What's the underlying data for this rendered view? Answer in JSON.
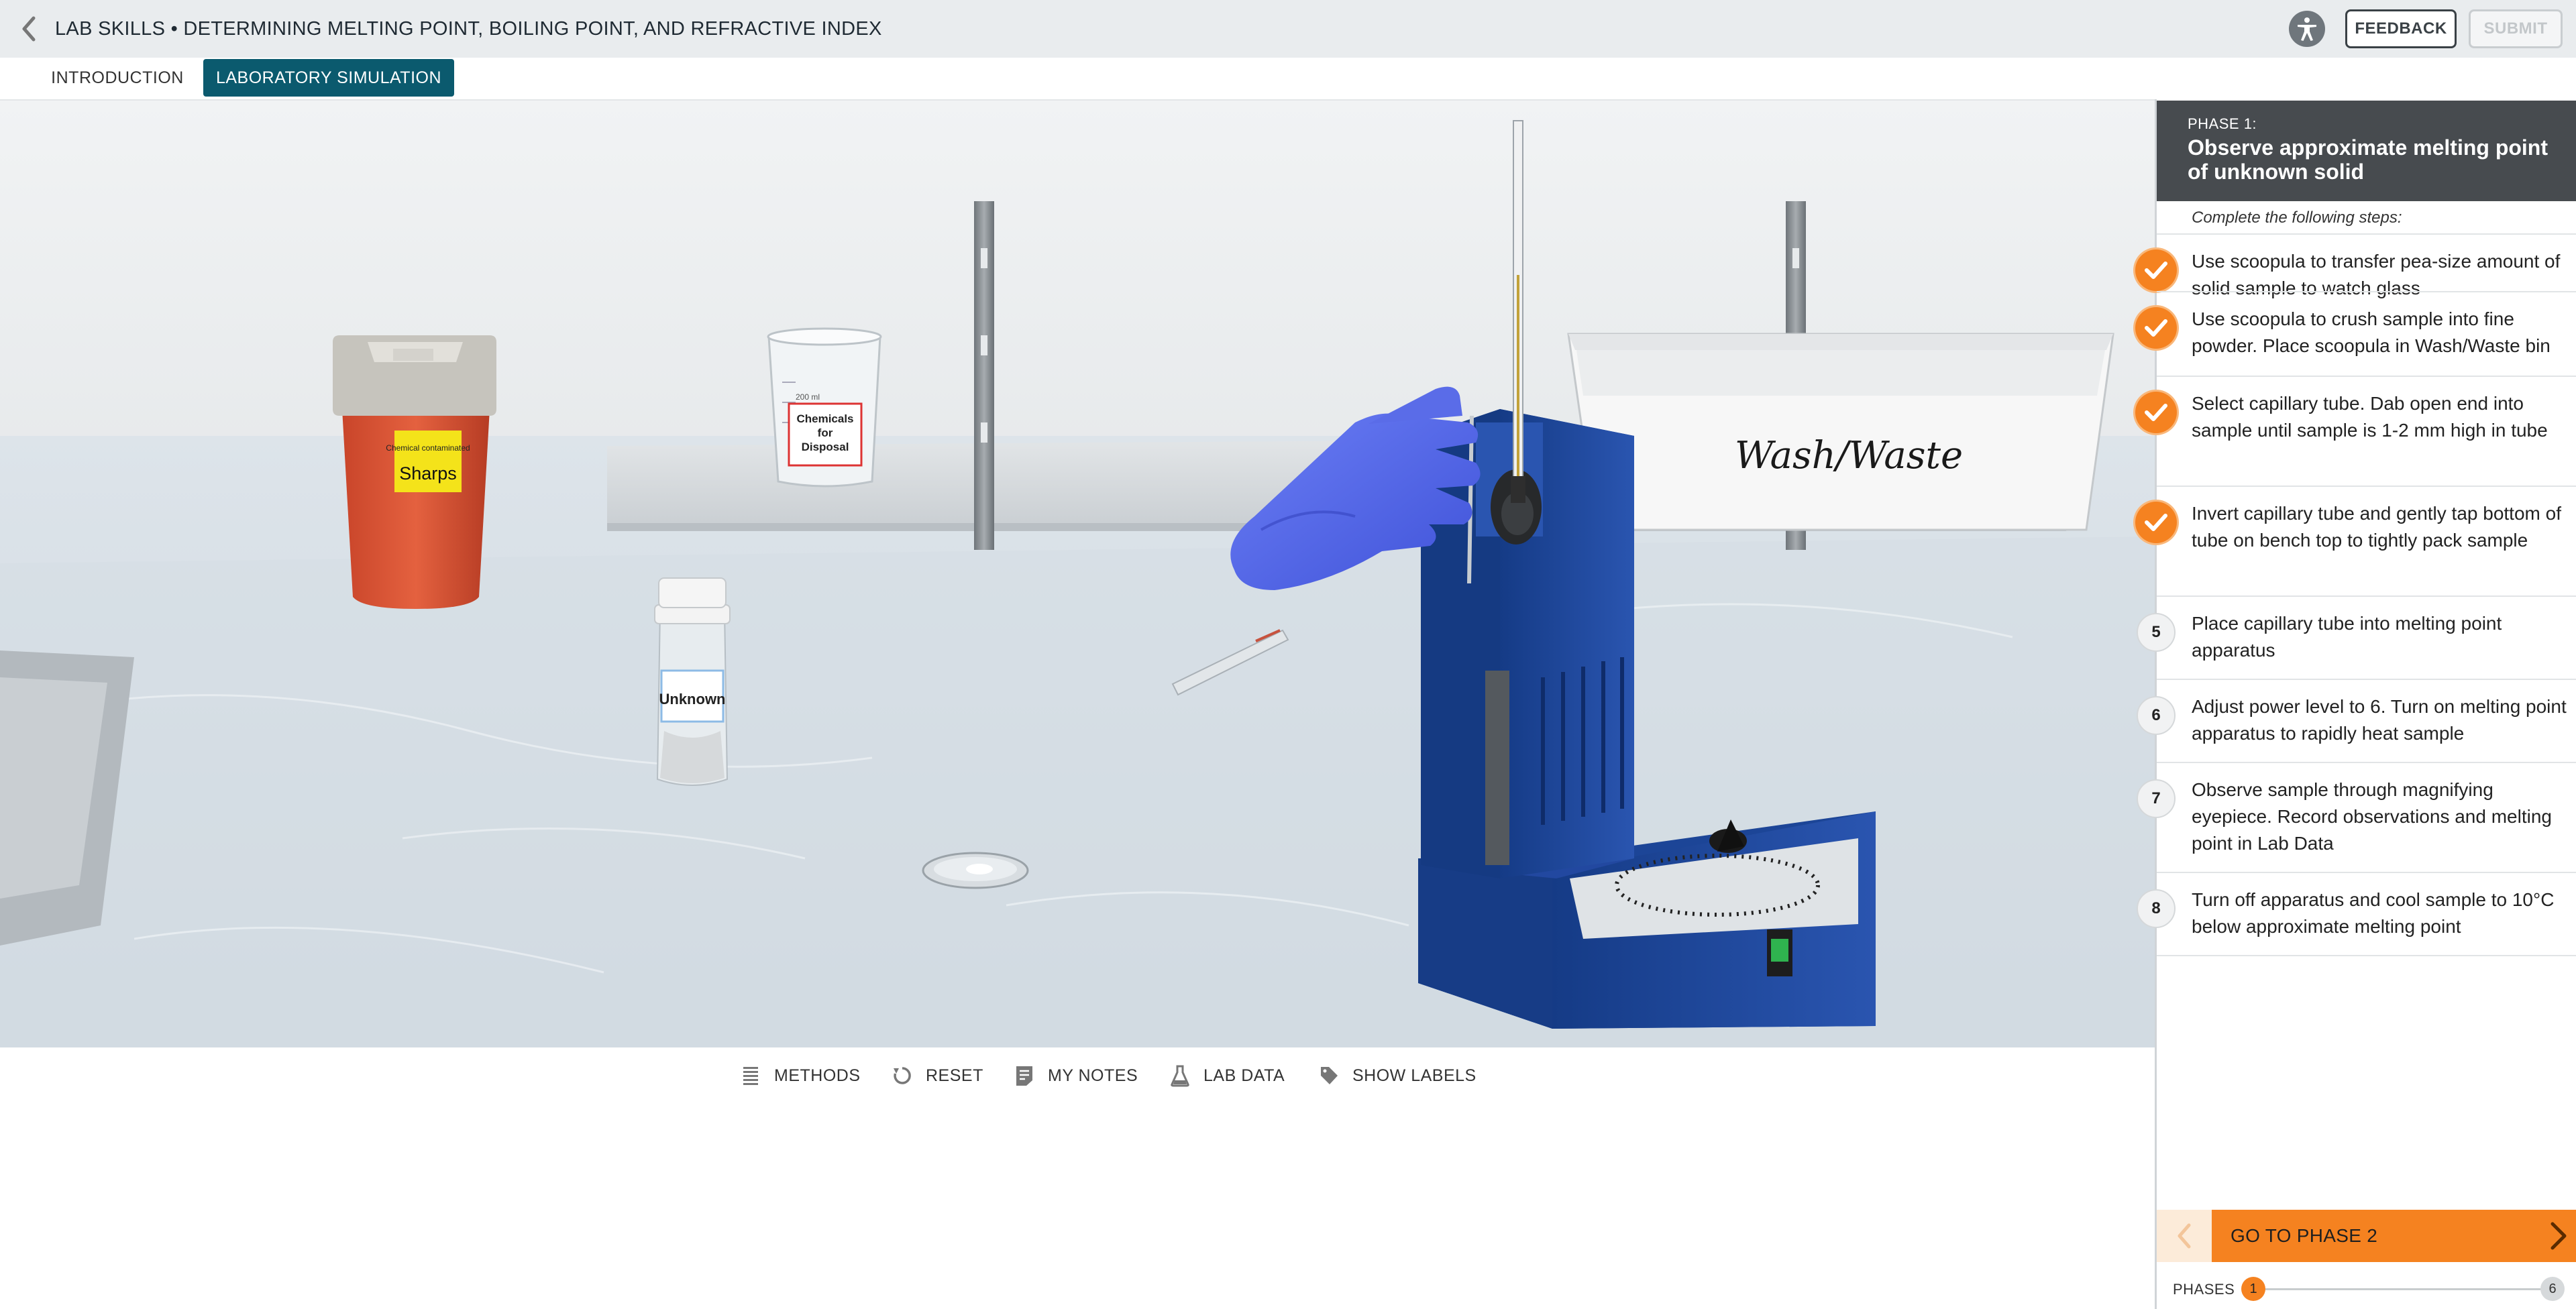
{
  "header": {
    "course_title": "LAB SKILLS • DETERMINING MELTING POINT, BOILING POINT, AND REFRACTIVE INDEX",
    "feedback_label": "FEEDBACK",
    "submit_label": "SUBMIT"
  },
  "tabs": [
    {
      "label": "INTRODUCTION",
      "active": false
    },
    {
      "label": "LABORATORY SIMULATION",
      "active": true
    }
  ],
  "scene": {
    "labels": {
      "sharps_small": "Chemical contaminated",
      "sharps_big": "Sharps",
      "beaker_volume": "200 ml",
      "beaker_label": [
        "Chemicals",
        "for",
        "Disposal"
      ],
      "bin_label": "Wash/Waste",
      "jar_label": "Unknown"
    }
  },
  "toolbar": {
    "methods": "METHODS",
    "reset": "RESET",
    "my_notes": "MY NOTES",
    "lab_data": "LAB DATA",
    "show_labels": "SHOW LABELS"
  },
  "panel": {
    "phase_label": "PHASE 1:",
    "phase_title": "Observe approximate melting point of unknown solid",
    "steps_intro": "Complete the following steps:",
    "steps": [
      {
        "number": "1",
        "done": true,
        "text": "Use scoopula to transfer pea-size amount of solid sample to watch glass"
      },
      {
        "number": "2",
        "done": true,
        "text": "Use scoopula to crush sample into fine powder. Place scoopula in Wash/Waste bin"
      },
      {
        "number": "3",
        "done": true,
        "text": "Select capillary tube. Dab open end into sample until sample is 1-2 mm high in tube"
      },
      {
        "number": "4",
        "done": true,
        "text": "Invert capillary tube and gently tap bottom of tube on bench top to tightly pack sample"
      },
      {
        "number": "5",
        "done": false,
        "text": "Place capillary tube into melting point apparatus"
      },
      {
        "number": "6",
        "done": false,
        "text": "Adjust power level to 6. Turn on melting point apparatus to rapidly heat sample"
      },
      {
        "number": "7",
        "done": false,
        "text": "Observe sample through magnifying eyepiece. Record observations and melting point in Lab Data"
      },
      {
        "number": "8",
        "done": false,
        "text": "Turn off apparatus and cool sample to 10°C below approximate melting point"
      }
    ],
    "next_label": "GO TO PHASE 2",
    "phases_label": "PHASES",
    "current_phase": "1",
    "total_phases": "6"
  },
  "colors": {
    "accent": "#f58220",
    "tab_active": "#0b5a6e",
    "panel_header": "#474b4f"
  }
}
